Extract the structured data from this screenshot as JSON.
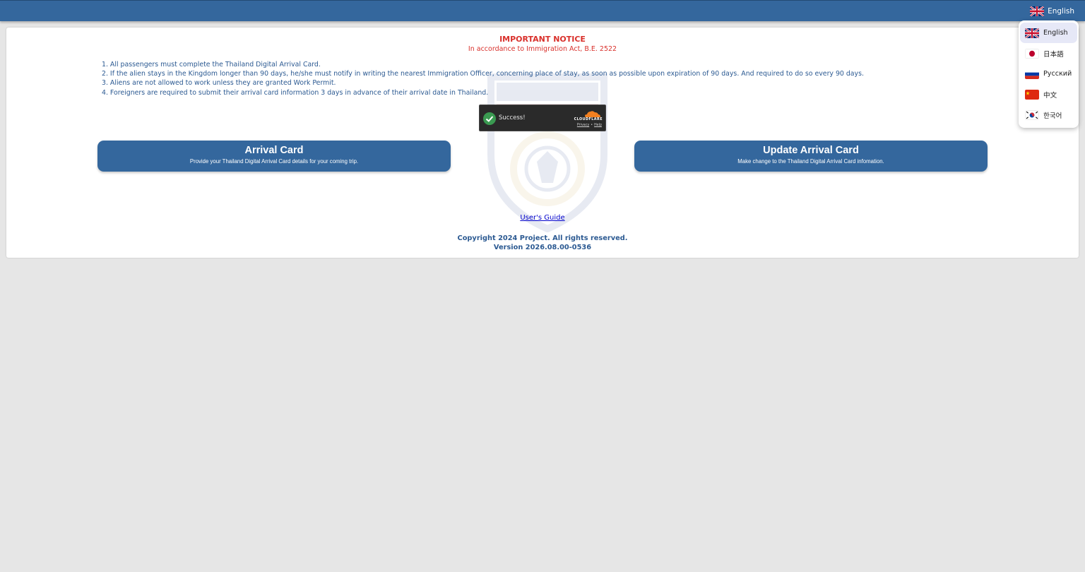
{
  "header": {
    "current_language": "English",
    "current_flag": "uk-flag"
  },
  "notice": {
    "title": "IMPORTANT NOTICE",
    "subtitle": "In accordance to Immigration Act, B.E. 2522",
    "rules": [
      "1. All passengers must complete the Thailand Digital Arrival Card.",
      "2. If the alien stays in the Kingdom longer than 90 days, he/she must notify in writing the nearest Immigration Officer, concerning place of stay, as soon as possible upon expiration of 90 days. And required to do so every 90 days.",
      "3. Aliens are not allowed to work unless they are granted Work Permit.",
      "4. Foreigners are required to submit their arrival card information 3 days in advance of their arrival date in Thailand."
    ]
  },
  "captcha": {
    "status": "Success!",
    "brand": "CLOUDFLARE",
    "privacy": "Privacy",
    "separator": "•",
    "help": "Help"
  },
  "actions": {
    "arrival": {
      "title": "Arrival Card",
      "description": "Provide your Thailand Digital Arrival Card details for your coming trip."
    },
    "update": {
      "title": "Update Arrival Card",
      "description": "Make change to the Thailand Digital Arrival Card infomation."
    }
  },
  "footer": {
    "guide": "User's Guide",
    "copyright": "Copyright 2024 Project. All rights reserved.",
    "version": "Version 2026.08.00-0536"
  },
  "languages": [
    {
      "label": "English",
      "flag": "uk-flag",
      "selected": true
    },
    {
      "label": "日本語",
      "flag": "japan-flag",
      "selected": false
    },
    {
      "label": "Русский",
      "flag": "russia-flag",
      "selected": false
    },
    {
      "label": "中文",
      "flag": "china-flag",
      "selected": false
    },
    {
      "label": "한국어",
      "flag": "korea-flag",
      "selected": false
    }
  ],
  "colors": {
    "primary": "#34679d",
    "notice_red": "#d9302b",
    "text_blue": "#2c5a92",
    "link": "#0000cc",
    "background": "#e6e6e6"
  }
}
